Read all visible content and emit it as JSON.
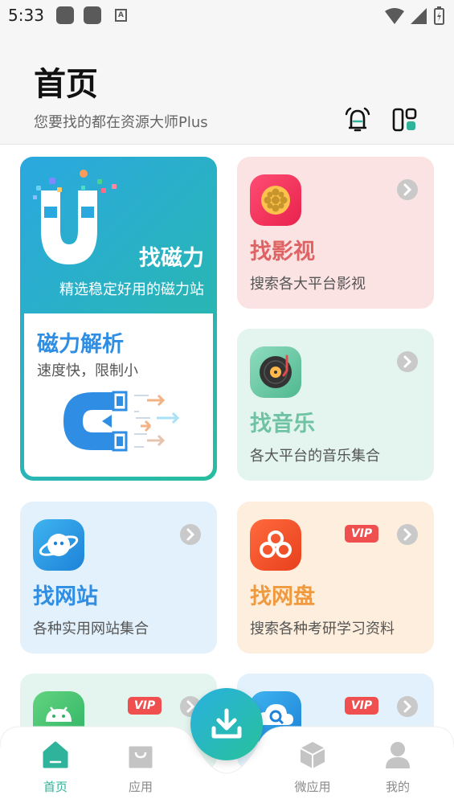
{
  "status_bar": {
    "time": "5:33"
  },
  "header": {
    "title": "首页",
    "subtitle": "您要找的都在资源大师Plus",
    "icons": [
      "bell-icon",
      "layout-icon"
    ]
  },
  "magnet_card": {
    "title": "找磁力",
    "desc": "精选稳定好用的磁力站",
    "analysis_title": "磁力解析",
    "analysis_desc": "速度快，限制小"
  },
  "cards": {
    "movie": {
      "title": "找影视",
      "desc": "搜索各大平台影视",
      "color": "#e06363",
      "bg": "#fbe3e3"
    },
    "music": {
      "title": "找音乐",
      "desc": "各大平台的音乐集合",
      "color": "#6fc3a4",
      "bg": "#e3f5ee"
    },
    "website": {
      "title": "找网站",
      "desc": "各种实用网站集合",
      "color": "#2f8ee3",
      "bg": "#e2f1fb"
    },
    "netdisk": {
      "title": "找网盘",
      "desc": "搜索各种考研学习资料",
      "color": "#ef9a3f",
      "bg": "#fdeedd",
      "badge": "VIP"
    },
    "apps": {
      "badge": "VIP",
      "bg": "#e3f5ee"
    },
    "cloud": {
      "badge": "VIP",
      "bg": "#e2f1fb"
    }
  },
  "nav": {
    "home": "首页",
    "apps": "应用",
    "micro_apps": "微应用",
    "mine": "我的",
    "active_color": "#2fb39a"
  }
}
